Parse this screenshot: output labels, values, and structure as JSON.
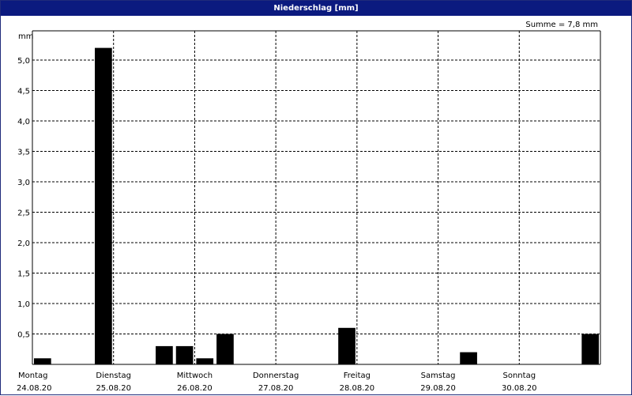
{
  "chart_data": {
    "type": "bar",
    "title": "Niederschlag [mm]",
    "ylabel": "mm",
    "summary": "Summe = 7,8 mm",
    "ylim": [
      0,
      5.5
    ],
    "yticks": [
      "0,5",
      "1,0",
      "1,5",
      "2,0",
      "2,5",
      "3,0",
      "3,5",
      "4,0",
      "4,5",
      "5,0"
    ],
    "ytick_values": [
      0.5,
      1.0,
      1.5,
      2.0,
      2.5,
      3.0,
      3.5,
      4.0,
      4.5,
      5.0
    ],
    "x_labels": [
      {
        "day": "Montag",
        "date": "24.08.20"
      },
      {
        "day": "Dienstag",
        "date": "25.08.20"
      },
      {
        "day": "Mittwoch",
        "date": "26.08.20"
      },
      {
        "day": "Donnerstag",
        "date": "27.08.20"
      },
      {
        "day": "Freitag",
        "date": "28.08.20"
      },
      {
        "day": "Samstag",
        "date": "29.08.20"
      },
      {
        "day": "Sonntag",
        "date": "30.08.20"
      }
    ],
    "x_unit": "hours since 24.08.20 00:00",
    "bar_width_hours": 6,
    "bars": [
      {
        "t": 0,
        "value": 0.1
      },
      {
        "t": 18,
        "value": 5.2
      },
      {
        "t": 36,
        "value": 0.3
      },
      {
        "t": 42,
        "value": 0.3
      },
      {
        "t": 48,
        "value": 0.1
      },
      {
        "t": 54,
        "value": 0.5
      },
      {
        "t": 90,
        "value": 0.6
      },
      {
        "t": 126,
        "value": 0.2
      },
      {
        "t": 162,
        "value": 0.5
      }
    ],
    "grid": true,
    "bar_color": "#000000",
    "background": "#ffffff",
    "title_bar_color": "#0b1a7f"
  }
}
